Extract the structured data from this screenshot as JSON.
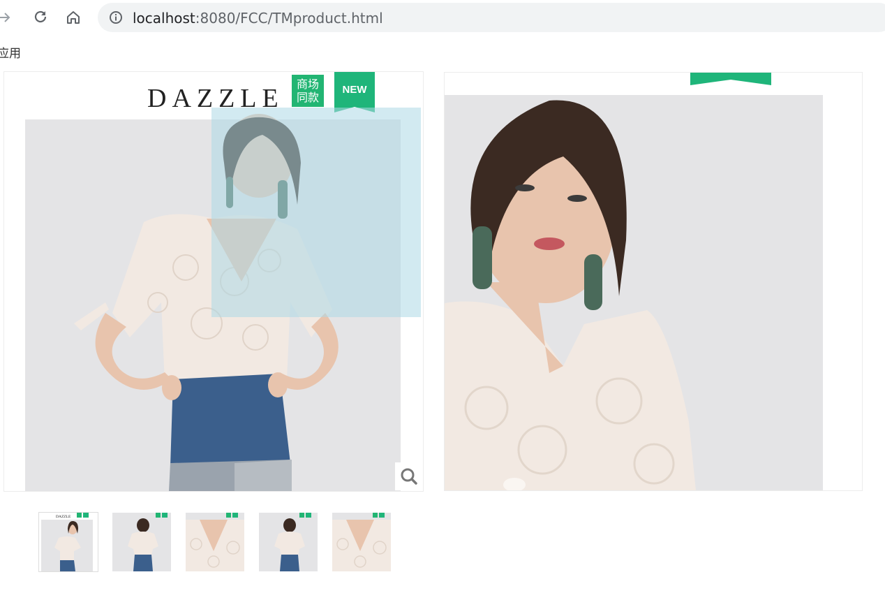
{
  "browser": {
    "url_host": "localhost",
    "url_path": ":8080/FCC/TMproduct.html",
    "bookmarks_label": "应用"
  },
  "product": {
    "brand_logo": "DAZZLE",
    "badge_mall": "商场\n同款",
    "badge_new": "NEW",
    "thumbnails": [
      {
        "name": "thumb-front",
        "variant": "front"
      },
      {
        "name": "thumb-back",
        "variant": "back"
      },
      {
        "name": "thumb-detail",
        "variant": "detail"
      },
      {
        "name": "thumb-back-2",
        "variant": "back"
      },
      {
        "name": "thumb-detail-2",
        "variant": "detail"
      }
    ]
  },
  "colors": {
    "badge_green": "#1fb57a",
    "lens": "#add8e6",
    "denim": "#3b5f8c"
  }
}
